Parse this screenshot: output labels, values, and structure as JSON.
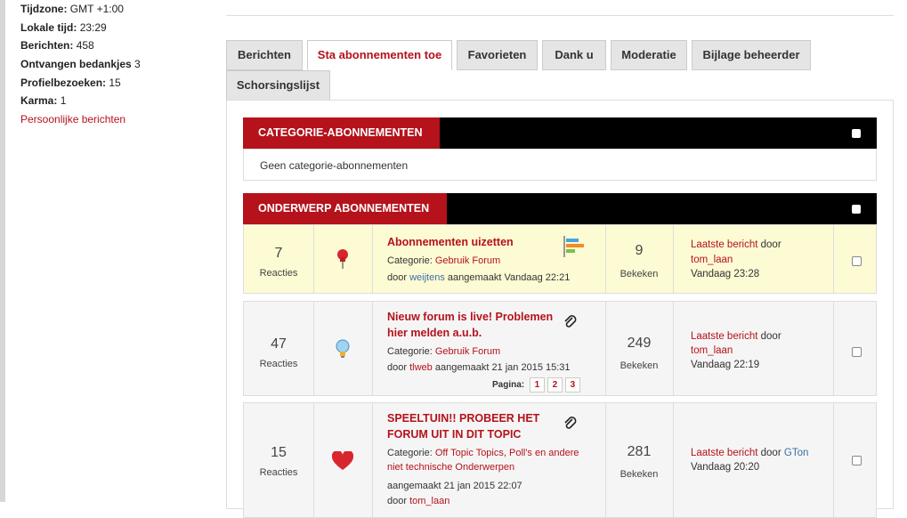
{
  "profile": {
    "timezone_label": "Tijdzone:",
    "timezone_value": "GMT +1:00",
    "localtime_label": "Lokale tijd:",
    "localtime_value": "23:29",
    "posts_label": "Berichten:",
    "posts_value": "458",
    "thanks_label": "Ontvangen bedankjes",
    "thanks_value": "3",
    "visits_label": "Profielbezoeken:",
    "visits_value": "15",
    "karma_label": "Karma:",
    "karma_value": "1",
    "pm_link": "Persoonlijke berichten"
  },
  "tabs": [
    "Berichten",
    "Sta abonnementen toe",
    "Favorieten",
    "Dank u",
    "Moderatie",
    "Bijlage beheerder",
    "Schorsingslijst"
  ],
  "category_section": {
    "header": "CATEGORIE-ABONNEMENTEN",
    "empty_text": "Geen categorie-abonnementen"
  },
  "topic_section": {
    "header": "ONDERWERP ABONNEMENTEN",
    "topics": [
      {
        "replies": "7",
        "replies_label": "Reacties",
        "title": "Abonnementen uizetten",
        "category_label": "Categorie:",
        "category": "Gebruik Forum",
        "by_prefix": "door",
        "author": "weijtens",
        "created": "aangemaakt Vandaag 22:21",
        "views": "9",
        "views_label": "Bekeken",
        "last_label": "Laatste bericht",
        "last_by": "door",
        "last_user": "tom_laan",
        "last_time": "Vandaag 23:28"
      },
      {
        "replies": "47",
        "replies_label": "Reacties",
        "title_line1": "Nieuw forum is live! Problemen",
        "title_line2": "hier melden a.u.b.",
        "category_label": "Categorie:",
        "category": "Gebruik Forum",
        "by_prefix": "door",
        "author": "tlweb",
        "created": "aangemaakt 21 jan 2015 15:31",
        "pages_label": "Pagina:",
        "pages": [
          "1",
          "2",
          "3"
        ],
        "views": "249",
        "views_label": "Bekeken",
        "last_label": "Laatste bericht",
        "last_by": "door",
        "last_user": "tom_laan",
        "last_time": "Vandaag 22:19"
      },
      {
        "replies": "15",
        "replies_label": "Reacties",
        "title_line1": "SPEELTUIN!! PROBEER HET",
        "title_line2": "FORUM UIT IN DIT TOPIC",
        "category_label": "Categorie:",
        "category_line1": "Off Topic Topics, Poll's en andere",
        "category_line2": "niet technische Onderwerpen",
        "created": "aangemaakt 21 jan 2015 22:07",
        "by_prefix": "door",
        "author": "tom_laan",
        "views": "281",
        "views_label": "Bekeken",
        "last_label": "Laatste bericht",
        "last_by": "door",
        "last_user": "GTon",
        "last_time": "Vandaag 20:20"
      }
    ]
  },
  "icons": {
    "pin": "pushpin-icon",
    "bulb": "lightbulb-icon",
    "heart": "heart-icon",
    "poll": "poll-icon",
    "attachment": "paperclip-icon"
  },
  "colors": {
    "accent": "#b5121b",
    "highlight_row": "#fdfbd4",
    "row_bg": "#f5f5f5"
  }
}
